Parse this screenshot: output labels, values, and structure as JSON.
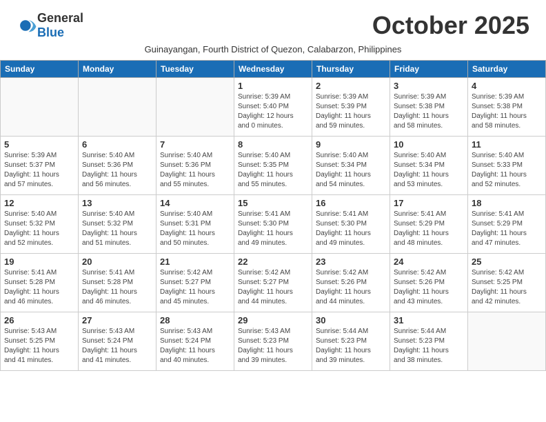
{
  "logo": {
    "general": "General",
    "blue": "Blue"
  },
  "title": "October 2025",
  "subtitle": "Guinayangan, Fourth District of Quezon, Calabarzon, Philippines",
  "days_of_week": [
    "Sunday",
    "Monday",
    "Tuesday",
    "Wednesday",
    "Thursday",
    "Friday",
    "Saturday"
  ],
  "weeks": [
    [
      {
        "day": "",
        "info": ""
      },
      {
        "day": "",
        "info": ""
      },
      {
        "day": "",
        "info": ""
      },
      {
        "day": "1",
        "info": "Sunrise: 5:39 AM\nSunset: 5:40 PM\nDaylight: 12 hours\nand 0 minutes."
      },
      {
        "day": "2",
        "info": "Sunrise: 5:39 AM\nSunset: 5:39 PM\nDaylight: 11 hours\nand 59 minutes."
      },
      {
        "day": "3",
        "info": "Sunrise: 5:39 AM\nSunset: 5:38 PM\nDaylight: 11 hours\nand 58 minutes."
      },
      {
        "day": "4",
        "info": "Sunrise: 5:39 AM\nSunset: 5:38 PM\nDaylight: 11 hours\nand 58 minutes."
      }
    ],
    [
      {
        "day": "5",
        "info": "Sunrise: 5:39 AM\nSunset: 5:37 PM\nDaylight: 11 hours\nand 57 minutes."
      },
      {
        "day": "6",
        "info": "Sunrise: 5:40 AM\nSunset: 5:36 PM\nDaylight: 11 hours\nand 56 minutes."
      },
      {
        "day": "7",
        "info": "Sunrise: 5:40 AM\nSunset: 5:36 PM\nDaylight: 11 hours\nand 55 minutes."
      },
      {
        "day": "8",
        "info": "Sunrise: 5:40 AM\nSunset: 5:35 PM\nDaylight: 11 hours\nand 55 minutes."
      },
      {
        "day": "9",
        "info": "Sunrise: 5:40 AM\nSunset: 5:34 PM\nDaylight: 11 hours\nand 54 minutes."
      },
      {
        "day": "10",
        "info": "Sunrise: 5:40 AM\nSunset: 5:34 PM\nDaylight: 11 hours\nand 53 minutes."
      },
      {
        "day": "11",
        "info": "Sunrise: 5:40 AM\nSunset: 5:33 PM\nDaylight: 11 hours\nand 52 minutes."
      }
    ],
    [
      {
        "day": "12",
        "info": "Sunrise: 5:40 AM\nSunset: 5:32 PM\nDaylight: 11 hours\nand 52 minutes."
      },
      {
        "day": "13",
        "info": "Sunrise: 5:40 AM\nSunset: 5:32 PM\nDaylight: 11 hours\nand 51 minutes."
      },
      {
        "day": "14",
        "info": "Sunrise: 5:40 AM\nSunset: 5:31 PM\nDaylight: 11 hours\nand 50 minutes."
      },
      {
        "day": "15",
        "info": "Sunrise: 5:41 AM\nSunset: 5:30 PM\nDaylight: 11 hours\nand 49 minutes."
      },
      {
        "day": "16",
        "info": "Sunrise: 5:41 AM\nSunset: 5:30 PM\nDaylight: 11 hours\nand 49 minutes."
      },
      {
        "day": "17",
        "info": "Sunrise: 5:41 AM\nSunset: 5:29 PM\nDaylight: 11 hours\nand 48 minutes."
      },
      {
        "day": "18",
        "info": "Sunrise: 5:41 AM\nSunset: 5:29 PM\nDaylight: 11 hours\nand 47 minutes."
      }
    ],
    [
      {
        "day": "19",
        "info": "Sunrise: 5:41 AM\nSunset: 5:28 PM\nDaylight: 11 hours\nand 46 minutes."
      },
      {
        "day": "20",
        "info": "Sunrise: 5:41 AM\nSunset: 5:28 PM\nDaylight: 11 hours\nand 46 minutes."
      },
      {
        "day": "21",
        "info": "Sunrise: 5:42 AM\nSunset: 5:27 PM\nDaylight: 11 hours\nand 45 minutes."
      },
      {
        "day": "22",
        "info": "Sunrise: 5:42 AM\nSunset: 5:27 PM\nDaylight: 11 hours\nand 44 minutes."
      },
      {
        "day": "23",
        "info": "Sunrise: 5:42 AM\nSunset: 5:26 PM\nDaylight: 11 hours\nand 44 minutes."
      },
      {
        "day": "24",
        "info": "Sunrise: 5:42 AM\nSunset: 5:26 PM\nDaylight: 11 hours\nand 43 minutes."
      },
      {
        "day": "25",
        "info": "Sunrise: 5:42 AM\nSunset: 5:25 PM\nDaylight: 11 hours\nand 42 minutes."
      }
    ],
    [
      {
        "day": "26",
        "info": "Sunrise: 5:43 AM\nSunset: 5:25 PM\nDaylight: 11 hours\nand 41 minutes."
      },
      {
        "day": "27",
        "info": "Sunrise: 5:43 AM\nSunset: 5:24 PM\nDaylight: 11 hours\nand 41 minutes."
      },
      {
        "day": "28",
        "info": "Sunrise: 5:43 AM\nSunset: 5:24 PM\nDaylight: 11 hours\nand 40 minutes."
      },
      {
        "day": "29",
        "info": "Sunrise: 5:43 AM\nSunset: 5:23 PM\nDaylight: 11 hours\nand 39 minutes."
      },
      {
        "day": "30",
        "info": "Sunrise: 5:44 AM\nSunset: 5:23 PM\nDaylight: 11 hours\nand 39 minutes."
      },
      {
        "day": "31",
        "info": "Sunrise: 5:44 AM\nSunset: 5:23 PM\nDaylight: 11 hours\nand 38 minutes."
      },
      {
        "day": "",
        "info": ""
      }
    ]
  ]
}
